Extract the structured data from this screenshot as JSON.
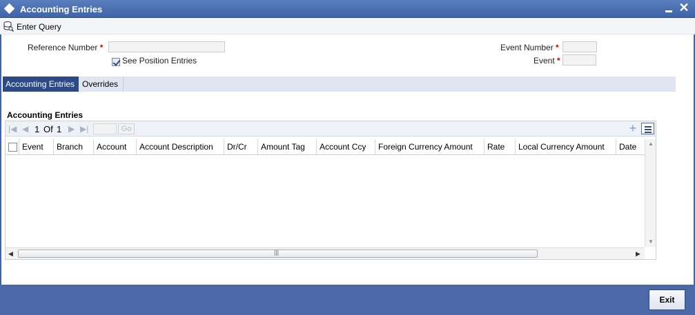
{
  "window": {
    "title": "Accounting Entries",
    "minimize_icon": "minimize-icon",
    "close_icon": "close-icon",
    "close_glyph": "✕"
  },
  "toolbar": {
    "enter_query_label": "Enter Query"
  },
  "form": {
    "reference_number_label": "Reference Number",
    "reference_number_value": "",
    "see_position_entries_label": "See Position Entries",
    "see_position_entries_checked": true,
    "event_number_label": "Event Number",
    "event_number_value": "",
    "event_label": "Event",
    "event_value": "",
    "required_marker": "*"
  },
  "tabs": [
    {
      "label": "Accounting Entries",
      "active": true
    },
    {
      "label": "Overrides",
      "active": false
    }
  ],
  "grid": {
    "section_title": "Accounting Entries",
    "pager": {
      "current_page": "1",
      "of_label": "Of",
      "total_pages": "1",
      "go_label": "Go"
    },
    "columns": [
      "Event",
      "Branch",
      "Account",
      "Account Description",
      "Dr/Cr",
      "Amount Tag",
      "Account Ccy",
      "Foreign Currency Amount",
      "Rate",
      "Local Currency Amount",
      "Date"
    ],
    "rows": []
  },
  "footer": {
    "exit_label": "Exit"
  },
  "colors": {
    "titlebar": "#3f64a8",
    "active_tab": "#2c4a86",
    "footer": "#4a69a6",
    "required": "#cc0000"
  }
}
